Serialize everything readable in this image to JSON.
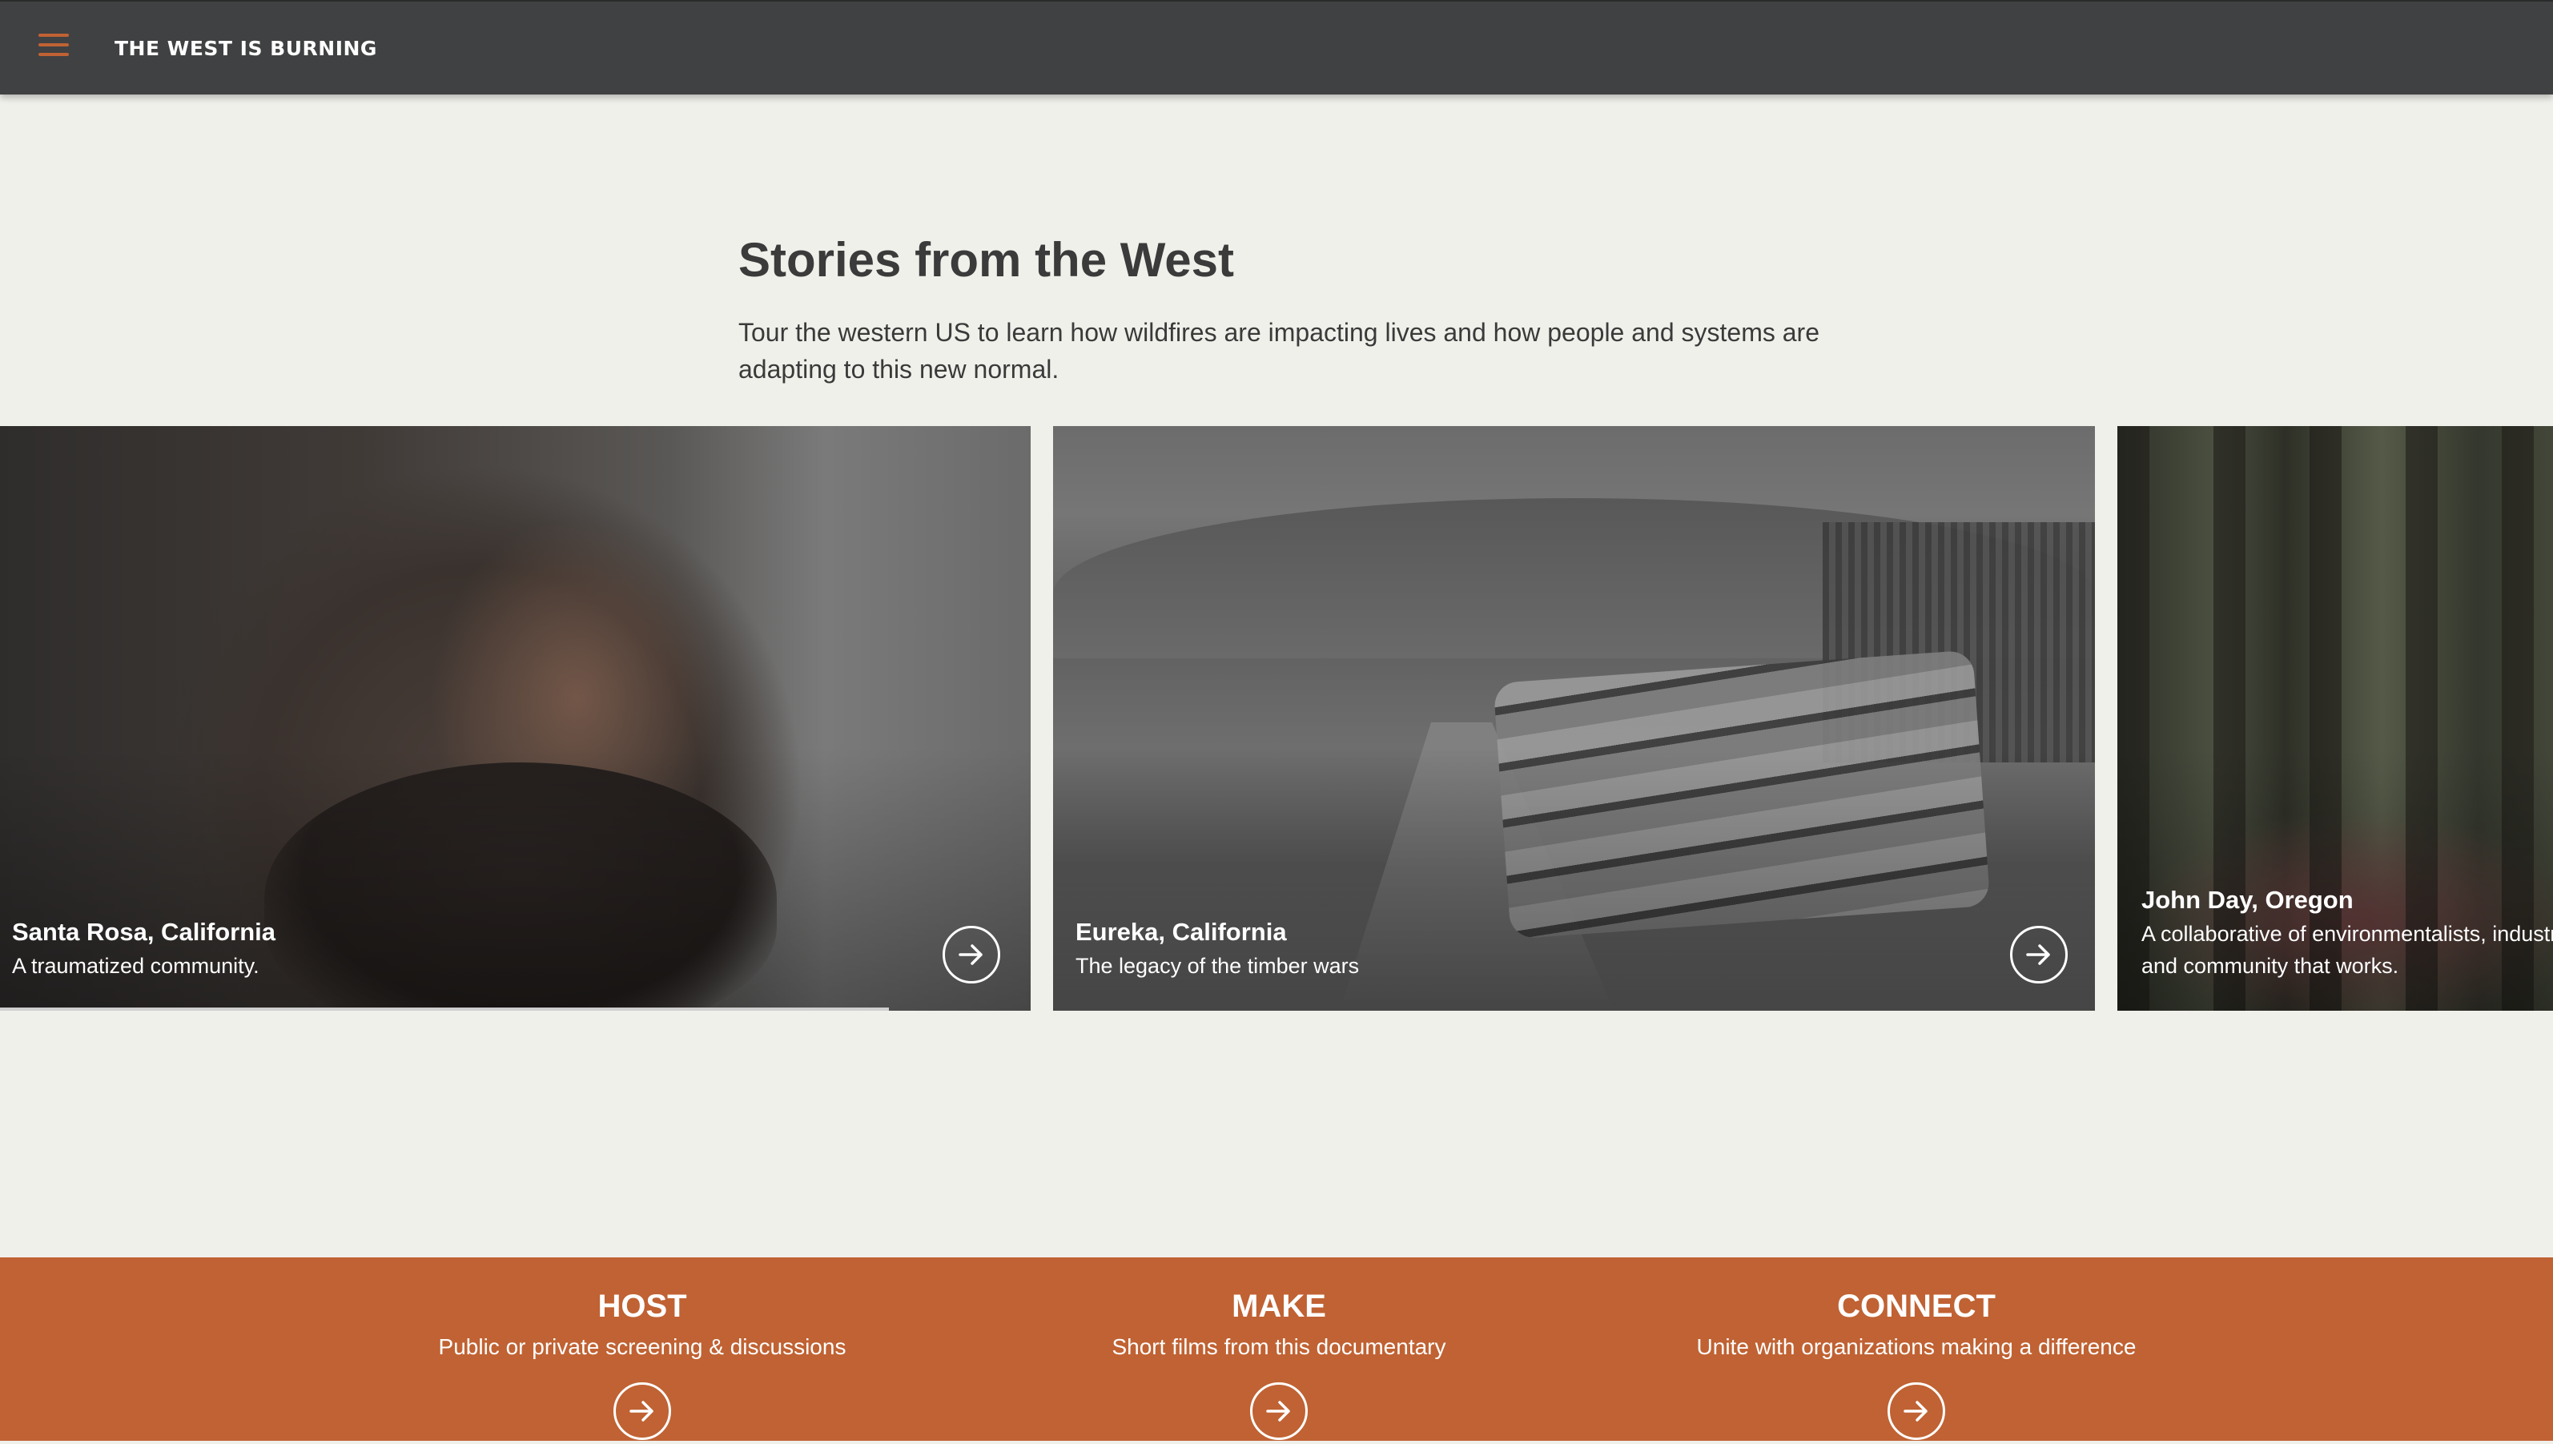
{
  "header": {
    "site_title": "THE WEST IS BURNING",
    "accent_color": "#c06233",
    "bar_color": "#404142"
  },
  "intro": {
    "title": "Stories from the West",
    "description": "Tour the western US to learn how wildfires are impacting lives and how people and systems are adapting to this new normal."
  },
  "cards": [
    {
      "title": "Santa Rosa, California",
      "subtitle": "A traumatized community."
    },
    {
      "title": "Eureka, California",
      "subtitle": "The legacy of the timber wars"
    },
    {
      "title": "John Day, Oregon",
      "subtitle": "A collaborative of environmentalists, industry and community that works."
    }
  ],
  "footer": {
    "color": "#c06233",
    "items": [
      {
        "heading": "HOST",
        "description": "Public or private screening & discussions"
      },
      {
        "heading": "MAKE",
        "description": "Short films from this documentary"
      },
      {
        "heading": "CONNECT",
        "description": "Unite with organizations making a difference"
      }
    ]
  }
}
